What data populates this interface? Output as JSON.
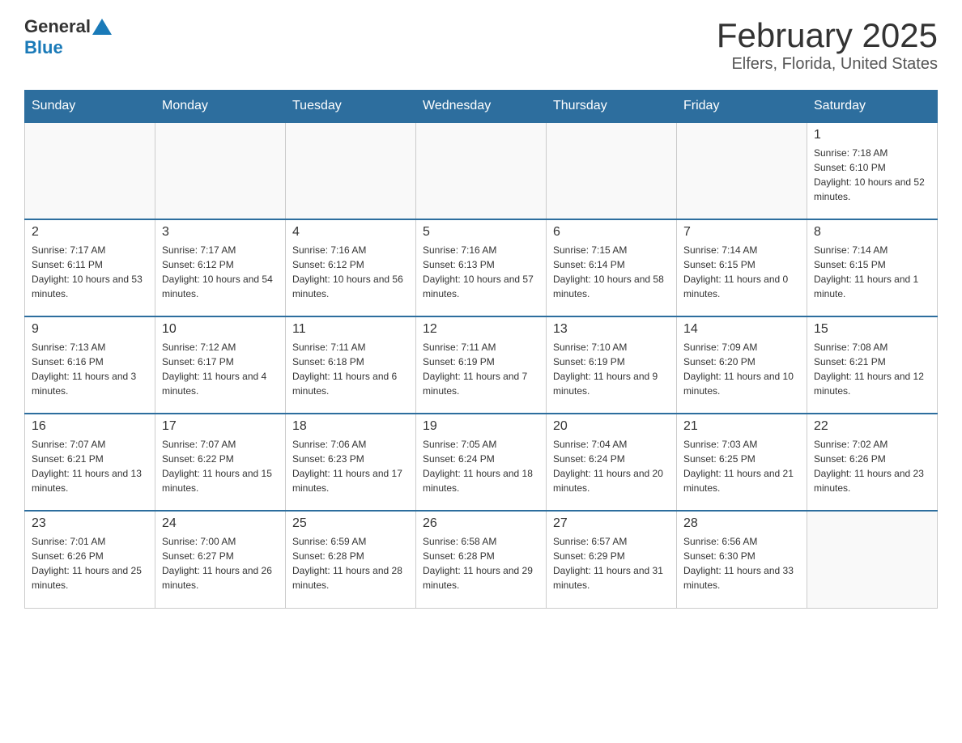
{
  "header": {
    "logo_general": "General",
    "logo_blue": "Blue",
    "title": "February 2025",
    "subtitle": "Elfers, Florida, United States"
  },
  "days_of_week": [
    "Sunday",
    "Monday",
    "Tuesday",
    "Wednesday",
    "Thursday",
    "Friday",
    "Saturday"
  ],
  "weeks": [
    [
      {
        "day": "",
        "sunrise": "",
        "sunset": "",
        "daylight": ""
      },
      {
        "day": "",
        "sunrise": "",
        "sunset": "",
        "daylight": ""
      },
      {
        "day": "",
        "sunrise": "",
        "sunset": "",
        "daylight": ""
      },
      {
        "day": "",
        "sunrise": "",
        "sunset": "",
        "daylight": ""
      },
      {
        "day": "",
        "sunrise": "",
        "sunset": "",
        "daylight": ""
      },
      {
        "day": "",
        "sunrise": "",
        "sunset": "",
        "daylight": ""
      },
      {
        "day": "1",
        "sunrise": "Sunrise: 7:18 AM",
        "sunset": "Sunset: 6:10 PM",
        "daylight": "Daylight: 10 hours and 52 minutes."
      }
    ],
    [
      {
        "day": "2",
        "sunrise": "Sunrise: 7:17 AM",
        "sunset": "Sunset: 6:11 PM",
        "daylight": "Daylight: 10 hours and 53 minutes."
      },
      {
        "day": "3",
        "sunrise": "Sunrise: 7:17 AM",
        "sunset": "Sunset: 6:12 PM",
        "daylight": "Daylight: 10 hours and 54 minutes."
      },
      {
        "day": "4",
        "sunrise": "Sunrise: 7:16 AM",
        "sunset": "Sunset: 6:12 PM",
        "daylight": "Daylight: 10 hours and 56 minutes."
      },
      {
        "day": "5",
        "sunrise": "Sunrise: 7:16 AM",
        "sunset": "Sunset: 6:13 PM",
        "daylight": "Daylight: 10 hours and 57 minutes."
      },
      {
        "day": "6",
        "sunrise": "Sunrise: 7:15 AM",
        "sunset": "Sunset: 6:14 PM",
        "daylight": "Daylight: 10 hours and 58 minutes."
      },
      {
        "day": "7",
        "sunrise": "Sunrise: 7:14 AM",
        "sunset": "Sunset: 6:15 PM",
        "daylight": "Daylight: 11 hours and 0 minutes."
      },
      {
        "day": "8",
        "sunrise": "Sunrise: 7:14 AM",
        "sunset": "Sunset: 6:15 PM",
        "daylight": "Daylight: 11 hours and 1 minute."
      }
    ],
    [
      {
        "day": "9",
        "sunrise": "Sunrise: 7:13 AM",
        "sunset": "Sunset: 6:16 PM",
        "daylight": "Daylight: 11 hours and 3 minutes."
      },
      {
        "day": "10",
        "sunrise": "Sunrise: 7:12 AM",
        "sunset": "Sunset: 6:17 PM",
        "daylight": "Daylight: 11 hours and 4 minutes."
      },
      {
        "day": "11",
        "sunrise": "Sunrise: 7:11 AM",
        "sunset": "Sunset: 6:18 PM",
        "daylight": "Daylight: 11 hours and 6 minutes."
      },
      {
        "day": "12",
        "sunrise": "Sunrise: 7:11 AM",
        "sunset": "Sunset: 6:19 PM",
        "daylight": "Daylight: 11 hours and 7 minutes."
      },
      {
        "day": "13",
        "sunrise": "Sunrise: 7:10 AM",
        "sunset": "Sunset: 6:19 PM",
        "daylight": "Daylight: 11 hours and 9 minutes."
      },
      {
        "day": "14",
        "sunrise": "Sunrise: 7:09 AM",
        "sunset": "Sunset: 6:20 PM",
        "daylight": "Daylight: 11 hours and 10 minutes."
      },
      {
        "day": "15",
        "sunrise": "Sunrise: 7:08 AM",
        "sunset": "Sunset: 6:21 PM",
        "daylight": "Daylight: 11 hours and 12 minutes."
      }
    ],
    [
      {
        "day": "16",
        "sunrise": "Sunrise: 7:07 AM",
        "sunset": "Sunset: 6:21 PM",
        "daylight": "Daylight: 11 hours and 13 minutes."
      },
      {
        "day": "17",
        "sunrise": "Sunrise: 7:07 AM",
        "sunset": "Sunset: 6:22 PM",
        "daylight": "Daylight: 11 hours and 15 minutes."
      },
      {
        "day": "18",
        "sunrise": "Sunrise: 7:06 AM",
        "sunset": "Sunset: 6:23 PM",
        "daylight": "Daylight: 11 hours and 17 minutes."
      },
      {
        "day": "19",
        "sunrise": "Sunrise: 7:05 AM",
        "sunset": "Sunset: 6:24 PM",
        "daylight": "Daylight: 11 hours and 18 minutes."
      },
      {
        "day": "20",
        "sunrise": "Sunrise: 7:04 AM",
        "sunset": "Sunset: 6:24 PM",
        "daylight": "Daylight: 11 hours and 20 minutes."
      },
      {
        "day": "21",
        "sunrise": "Sunrise: 7:03 AM",
        "sunset": "Sunset: 6:25 PM",
        "daylight": "Daylight: 11 hours and 21 minutes."
      },
      {
        "day": "22",
        "sunrise": "Sunrise: 7:02 AM",
        "sunset": "Sunset: 6:26 PM",
        "daylight": "Daylight: 11 hours and 23 minutes."
      }
    ],
    [
      {
        "day": "23",
        "sunrise": "Sunrise: 7:01 AM",
        "sunset": "Sunset: 6:26 PM",
        "daylight": "Daylight: 11 hours and 25 minutes."
      },
      {
        "day": "24",
        "sunrise": "Sunrise: 7:00 AM",
        "sunset": "Sunset: 6:27 PM",
        "daylight": "Daylight: 11 hours and 26 minutes."
      },
      {
        "day": "25",
        "sunrise": "Sunrise: 6:59 AM",
        "sunset": "Sunset: 6:28 PM",
        "daylight": "Daylight: 11 hours and 28 minutes."
      },
      {
        "day": "26",
        "sunrise": "Sunrise: 6:58 AM",
        "sunset": "Sunset: 6:28 PM",
        "daylight": "Daylight: 11 hours and 29 minutes."
      },
      {
        "day": "27",
        "sunrise": "Sunrise: 6:57 AM",
        "sunset": "Sunset: 6:29 PM",
        "daylight": "Daylight: 11 hours and 31 minutes."
      },
      {
        "day": "28",
        "sunrise": "Sunrise: 6:56 AM",
        "sunset": "Sunset: 6:30 PM",
        "daylight": "Daylight: 11 hours and 33 minutes."
      },
      {
        "day": "",
        "sunrise": "",
        "sunset": "",
        "daylight": ""
      }
    ]
  ]
}
